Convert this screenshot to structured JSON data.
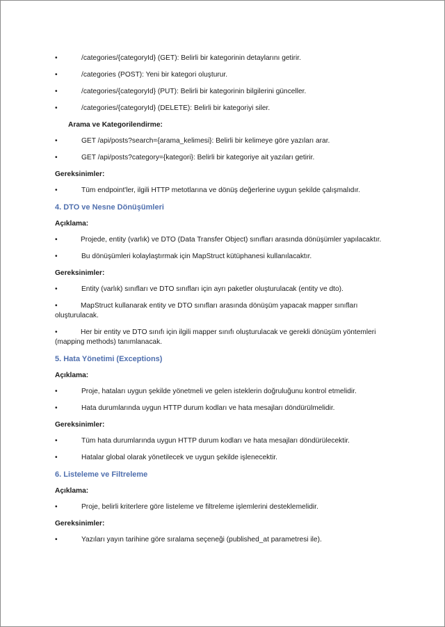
{
  "bullet_glyph": "•",
  "items": [
    {
      "kind": "bullet",
      "text": "/categories/{categoryId} (GET): Belirli bir kategorinin detaylarını getirir."
    },
    {
      "kind": "bullet",
      "text": "/categories (POST): Yeni bir kategori oluşturur."
    },
    {
      "kind": "bullet",
      "text": "/categories/{categoryId} (PUT): Belirli bir kategorinin bilgilerini günceller."
    },
    {
      "kind": "bullet",
      "text": "/categories/{categoryId} (DELETE): Belirli bir kategoriyi siler."
    },
    {
      "kind": "label-indent",
      "text": "Arama ve Kategorilendirme:"
    },
    {
      "kind": "bullet",
      "text": "GET /api/posts?search={arama_kelimesi}: Belirli bir kelimeye göre yazıları arar."
    },
    {
      "kind": "bullet",
      "text": "GET /api/posts?category={kategori}: Belirli bir kategoriye ait yazıları getirir."
    },
    {
      "kind": "label",
      "text": "Gereksinimler:"
    },
    {
      "kind": "bullet",
      "text": "Tüm endpoint'ler, ilgili HTTP metotlarına ve dönüş değerlerine uygun şekilde çalışmalıdır."
    },
    {
      "kind": "heading",
      "text": "4. DTO ve Nesne Dönüşümleri"
    },
    {
      "kind": "label",
      "text": "Açıklama:"
    },
    {
      "kind": "bullet",
      "text": "Projede, entity (varlık) ve DTO (Data Transfer Object) sınıfları arasında dönüşümler yapılacaktır."
    },
    {
      "kind": "bullet",
      "text": "Bu dönüşümleri kolaylaştırmak için MapStruct kütüphanesi kullanılacaktır."
    },
    {
      "kind": "label",
      "text": "Gereksinimler:"
    },
    {
      "kind": "bullet",
      "text": "Entity (varlık) sınıfları ve DTO sınıfları için ayrı paketler oluşturulacak (entity ve dto)."
    },
    {
      "kind": "bullet",
      "text": "MapStruct kullanarak entity ve DTO sınıfları arasında dönüşüm yapacak mapper sınıfları oluşturulacak."
    },
    {
      "kind": "bullet",
      "text": "Her bir entity ve DTO sınıfı için ilgili mapper sınıfı oluşturulacak ve gerekli dönüşüm yöntemleri (mapping methods) tanımlanacak."
    },
    {
      "kind": "heading",
      "text": "5. Hata Yönetimi (Exceptions)"
    },
    {
      "kind": "label",
      "text": "Açıklama:"
    },
    {
      "kind": "bullet",
      "text": "Proje, hataları uygun şekilde yönetmeli ve gelen isteklerin doğruluğunu kontrol etmelidir."
    },
    {
      "kind": "bullet",
      "text": "Hata durumlarında uygun HTTP durum kodları ve hata mesajları döndürülmelidir."
    },
    {
      "kind": "label",
      "text": "Gereksinimler:"
    },
    {
      "kind": "bullet",
      "text": "Tüm hata durumlarında uygun HTTP durum kodları ve hata mesajları döndürülecektir."
    },
    {
      "kind": "bullet",
      "text": "Hatalar global olarak yönetilecek ve uygun şekilde işlenecektir."
    },
    {
      "kind": "heading",
      "text": "6. Listeleme ve Filtreleme"
    },
    {
      "kind": "label",
      "text": "Açıklama:"
    },
    {
      "kind": "bullet",
      "text": "Proje, belirli kriterlere göre listeleme ve filtreleme işlemlerini desteklemelidir."
    },
    {
      "kind": "label",
      "text": "Gereksinimler:"
    },
    {
      "kind": "bullet",
      "text": "Yazıları yayın tarihine göre sıralama seçeneği (published_at parametresi ile)."
    }
  ]
}
